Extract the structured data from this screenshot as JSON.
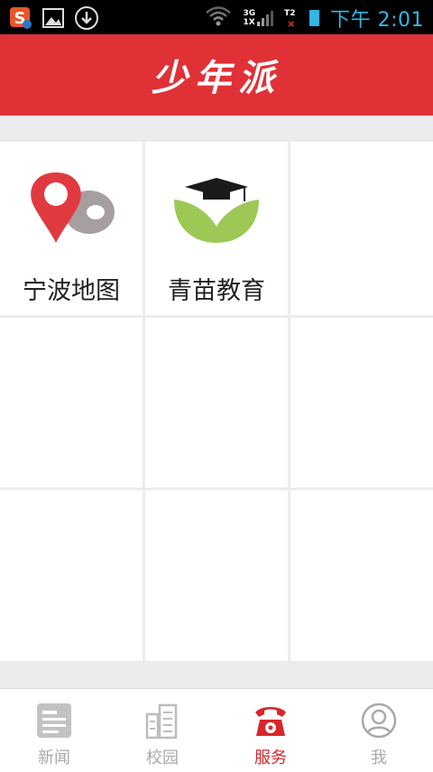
{
  "status_bar": {
    "time": "下午 2:01",
    "network_top": "3G",
    "network_bottom": "1X",
    "sim_label": "T2",
    "icons": [
      "sogou-input-icon",
      "image-notification-icon",
      "download-icon",
      "wifi-icon",
      "signal-icon",
      "battery-icon"
    ]
  },
  "header": {
    "title": "少年派"
  },
  "services": {
    "items": [
      {
        "label": "宁波地图",
        "icon": "map-pin-icon"
      },
      {
        "label": "青苗教育",
        "icon": "graduation-sprout-icon"
      },
      {
        "label": ""
      },
      {
        "label": ""
      },
      {
        "label": ""
      },
      {
        "label": ""
      },
      {
        "label": ""
      },
      {
        "label": ""
      },
      {
        "label": ""
      }
    ]
  },
  "tabs": [
    {
      "label": "新闻",
      "icon": "newspaper-icon",
      "active": false
    },
    {
      "label": "校园",
      "icon": "building-icon",
      "active": false
    },
    {
      "label": "服务",
      "icon": "telephone-icon",
      "active": true
    },
    {
      "label": "我",
      "icon": "user-icon",
      "active": false
    }
  ],
  "colors": {
    "brand": "#e03136",
    "active_tab": "#d8262b",
    "inactive_tab": "#a9a9a9",
    "status_time": "#33b5e5"
  }
}
